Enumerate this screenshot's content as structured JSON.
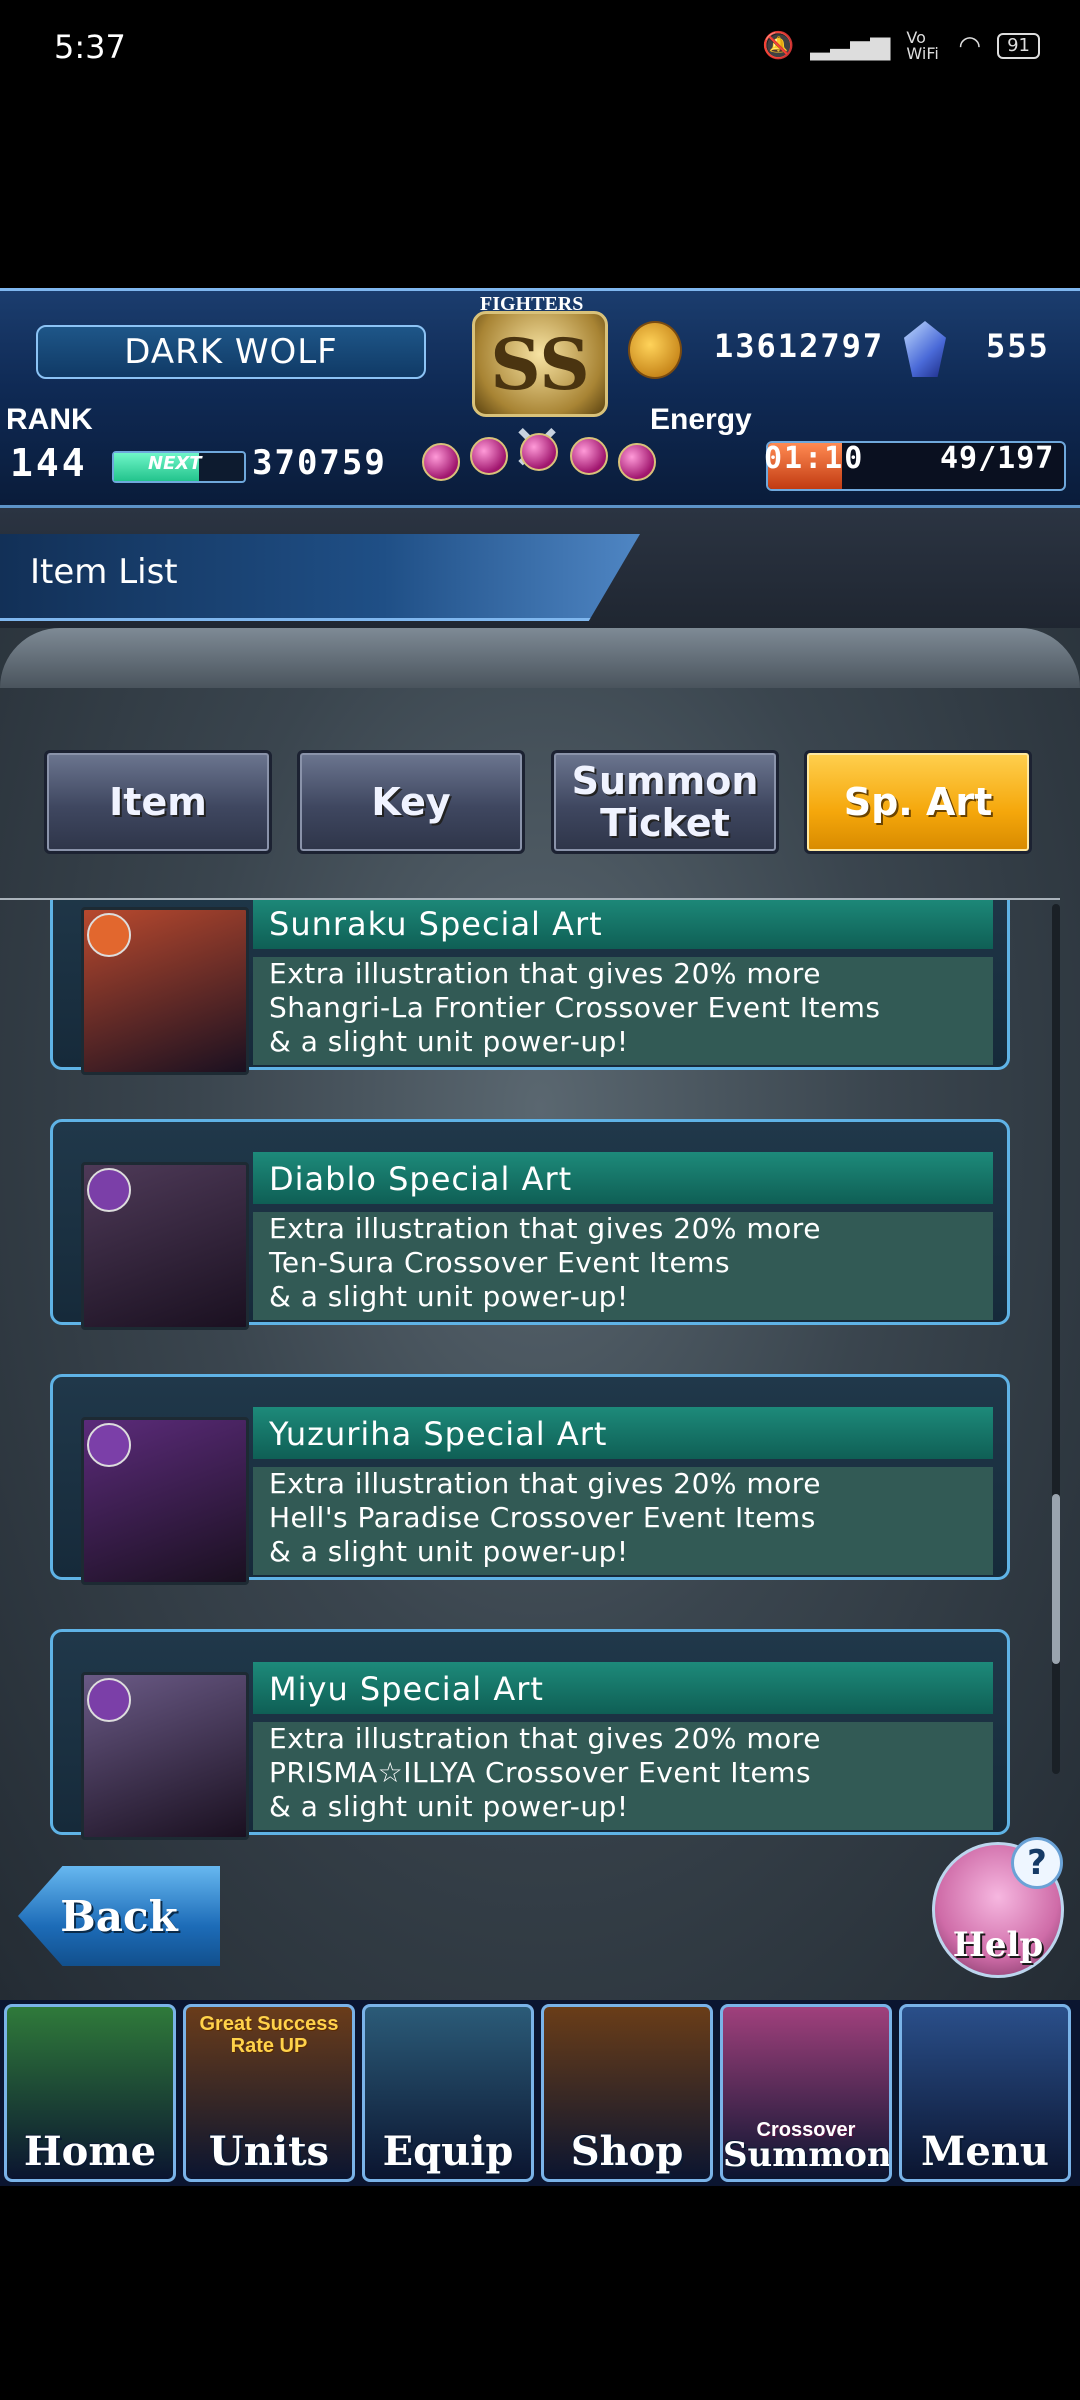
{
  "status_bar": {
    "time": "5:37",
    "battery": "91",
    "wifi_label": "Vo WiFi"
  },
  "header": {
    "player_name": "DARK WOLF",
    "rank_label": "RANK",
    "rank_value": "144",
    "next_label": "NEXT",
    "next_value": "370759",
    "exp_fraction": 0.65,
    "emblem_top": "FIGHTERS",
    "emblem_rank": "SS",
    "coins": "13612797",
    "gems": "555",
    "energy_label": "Energy",
    "energy_timer": "01:10",
    "energy_count": "49/197",
    "energy_fraction": 0.25
  },
  "page_title": "Item List",
  "tabs": [
    {
      "label": "Item"
    },
    {
      "label": "Key"
    },
    {
      "label": "Summon Ticket"
    },
    {
      "label": "Sp. Art",
      "active": true
    }
  ],
  "items": [
    {
      "name": "Sunraku Special Art",
      "desc": [
        "Extra illustration that gives 20% more",
        "Shangri-La Frontier Crossover Event Items",
        "& a slight unit power-up!"
      ],
      "thumb_color": "#b8492e",
      "badge_color": "#e2672e"
    },
    {
      "name": "Diablo Special Art",
      "desc": [
        "Extra illustration that gives 20% more",
        "Ten-Sura Crossover Event Items",
        "& a slight unit power-up!"
      ],
      "thumb_color": "#4e3a58",
      "badge_color": "#7b3fa8"
    },
    {
      "name": "Yuzuriha Special Art",
      "desc": [
        "Extra illustration that gives 20% more",
        "Hell's Paradise Crossover Event Items",
        "& a slight unit power-up!"
      ],
      "thumb_color": "#5b2b7a",
      "badge_color": "#7b3fa8"
    },
    {
      "name": "Miyu Special Art",
      "desc": [
        "Extra illustration that gives 20% more",
        "PRISMA☆ILLYA Crossover Event Items",
        "& a slight unit power-up!"
      ],
      "thumb_color": "#6a5a86",
      "badge_color": "#7b3fa8"
    }
  ],
  "back_label": "Back",
  "help_label": "Help",
  "nav": [
    {
      "label": "Home",
      "bg": "#2f7a3a"
    },
    {
      "label": "Units",
      "bg": "#6a3c1a",
      "top_text": "Great Success Rate UP"
    },
    {
      "label": "Equip",
      "bg": "#2b5b78"
    },
    {
      "label": "Shop",
      "bg": "#6a3d18"
    },
    {
      "label": "Summon",
      "bg": "#a0407c",
      "top_text": "Crossover"
    },
    {
      "label": "Menu",
      "bg": "#2a4f8a"
    }
  ]
}
